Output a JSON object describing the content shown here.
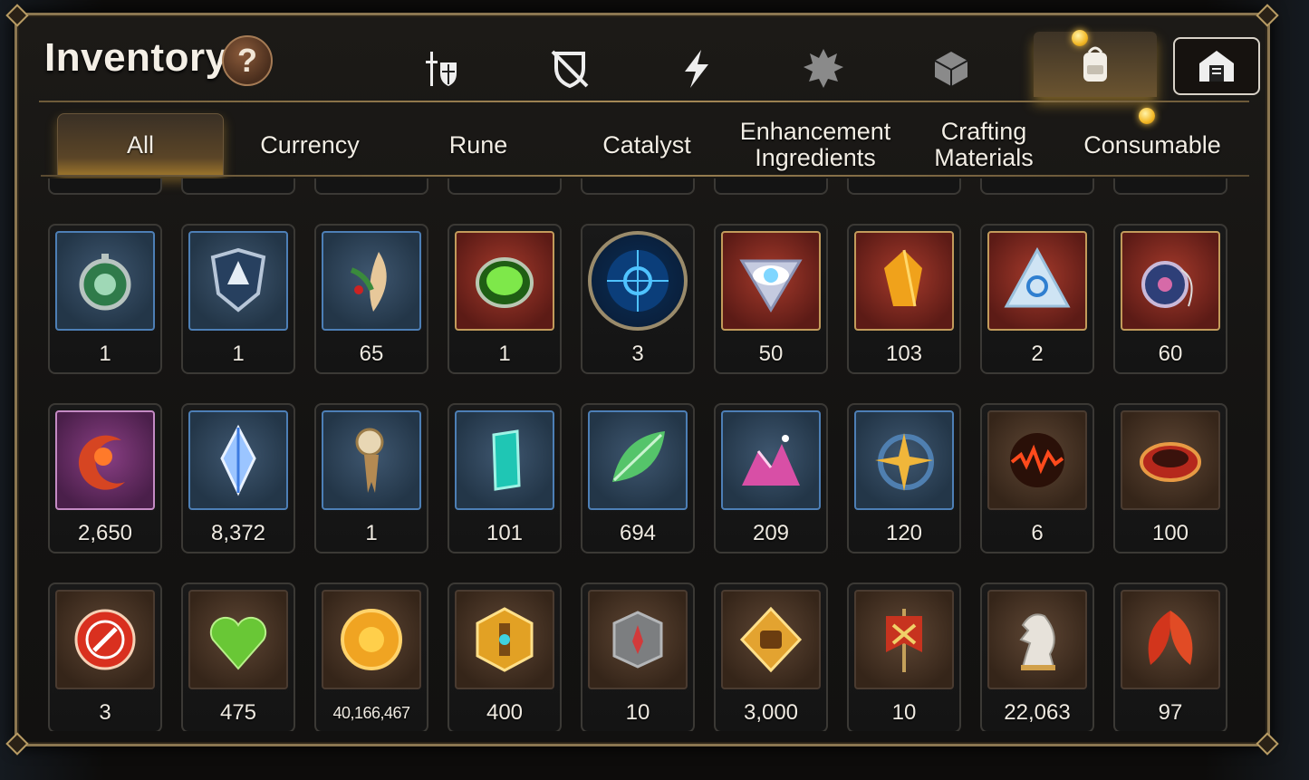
{
  "header": {
    "title": "Inventory",
    "help_label": "?"
  },
  "categories": [
    {
      "name": "equipment-icon"
    },
    {
      "name": "artifact-icon"
    },
    {
      "name": "skill-icon"
    },
    {
      "name": "summon-icon"
    },
    {
      "name": "dice-icon"
    },
    {
      "name": "backpack-icon",
      "active": true,
      "notify": true
    },
    {
      "name": "storage-icon"
    }
  ],
  "tabs": [
    {
      "label": "All",
      "active": true
    },
    {
      "label": "Currency"
    },
    {
      "label": "Rune"
    },
    {
      "label": "Catalyst"
    },
    {
      "label": "Enhancement Ingredients"
    },
    {
      "label": "Crafting Materials"
    },
    {
      "label": "Consumable",
      "notify": true
    }
  ],
  "colors": {
    "accent": "#f3b826",
    "frame_gold": "#8b7650"
  },
  "items": [
    {
      "count": "1",
      "icon": "stopwatch-icon",
      "frame": "blue"
    },
    {
      "count": "1",
      "icon": "shield-badge-icon",
      "frame": "blue"
    },
    {
      "count": "65",
      "icon": "feather-herb-icon",
      "frame": "blue"
    },
    {
      "count": "1",
      "icon": "green-orb-icon",
      "frame": "red"
    },
    {
      "count": "3",
      "icon": "blue-rune-disc-icon",
      "frame": "round"
    },
    {
      "count": "50",
      "icon": "eye-crest-icon",
      "frame": "red"
    },
    {
      "count": "103",
      "icon": "amber-crystal-icon",
      "frame": "red"
    },
    {
      "count": "2",
      "icon": "triangle-gem-icon",
      "frame": "red"
    },
    {
      "count": "60",
      "icon": "yoyo-charm-icon",
      "frame": "red"
    },
    {
      "count": "2,650",
      "icon": "crescent-flower-icon",
      "frame": "purple"
    },
    {
      "count": "8,372",
      "icon": "crystal-shard-icon",
      "frame": "blue"
    },
    {
      "count": "1",
      "icon": "pocket-watch-bookmark-icon",
      "frame": "blue"
    },
    {
      "count": "101",
      "icon": "teal-crystal-icon",
      "frame": "blue"
    },
    {
      "count": "694",
      "icon": "green-leaf-icon",
      "frame": "blue"
    },
    {
      "count": "209",
      "icon": "pink-crystal-pile-icon",
      "frame": "blue"
    },
    {
      "count": "120",
      "icon": "star-amulet-icon",
      "frame": "blue"
    },
    {
      "count": "6",
      "icon": "lava-orb-icon",
      "frame": "brown"
    },
    {
      "count": "100",
      "icon": "red-bracelet-icon",
      "frame": "brown"
    },
    {
      "count": "3",
      "icon": "red-seal-icon",
      "frame": "brown"
    },
    {
      "count": "475",
      "icon": "green-heart-icon",
      "frame": "brown"
    },
    {
      "count": "40,166,467",
      "icon": "gold-coin-icon",
      "frame": "brown",
      "small": true
    },
    {
      "count": "400",
      "icon": "gold-hex-medal-icon",
      "frame": "brown"
    },
    {
      "count": "10",
      "icon": "stone-compass-icon",
      "frame": "brown"
    },
    {
      "count": "3,000",
      "icon": "fist-medal-icon",
      "frame": "brown"
    },
    {
      "count": "10",
      "icon": "war-banner-icon",
      "frame": "brown"
    },
    {
      "count": "22,063",
      "icon": "chess-knight-icon",
      "frame": "brown"
    },
    {
      "count": "97",
      "icon": "red-leaves-icon",
      "frame": "brown"
    }
  ]
}
